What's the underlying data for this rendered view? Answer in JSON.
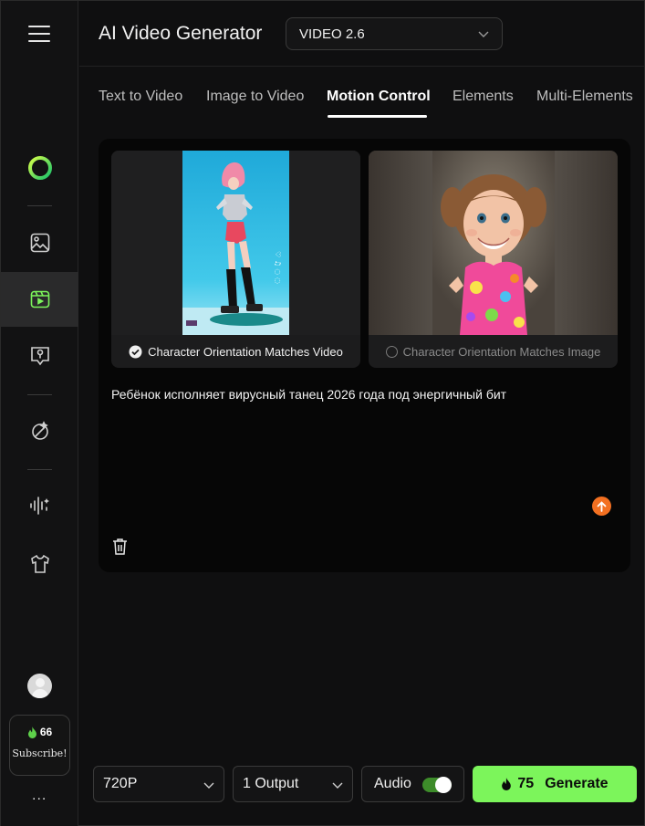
{
  "app": {
    "title": "AI Video Generator"
  },
  "model_select": {
    "value": "VIDEO 2.6"
  },
  "tabs": [
    {
      "label": "Text to Video"
    },
    {
      "label": "Image to Video"
    },
    {
      "label": "Motion Control",
      "active": true
    },
    {
      "label": "Elements"
    },
    {
      "label": "Multi-Elements"
    }
  ],
  "sidebar": {
    "icons": [
      "kling-logo-icon",
      "image-icon",
      "video-icon",
      "avatar-effect-icon",
      "magic-edit-icon",
      "audio-icon",
      "tshirt-icon"
    ],
    "credits": "66",
    "subscribe_label": "Subscribe!",
    "more_label": "..."
  },
  "cards": {
    "video": {
      "caption": "Character Orientation Matches Video",
      "selected": true
    },
    "image": {
      "caption": "Character Orientation Matches Image",
      "selected": false
    }
  },
  "prompt": {
    "text": "Ребёнок исполняет вирусный танец 2026 года под энергичный бит"
  },
  "controls": {
    "resolution": "720P",
    "outputs": "1 Output",
    "audio_label": "Audio",
    "audio_on": true
  },
  "generate": {
    "cost": "75",
    "label": "Generate"
  },
  "colors": {
    "accent": "#7cf55b",
    "upload": "#f37021",
    "toggle_on": "#3d8c2a"
  }
}
